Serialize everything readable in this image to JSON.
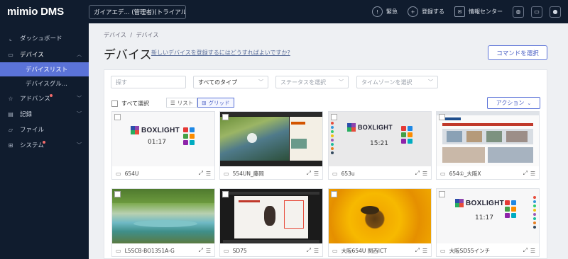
{
  "app": {
    "logo": "mimio DMS",
    "tenant": "ガイアエデ... (管理者)(トライアル)"
  },
  "topbar": {
    "emergency": "緊急",
    "register": "登録する",
    "info_center": "情報センター"
  },
  "sidebar": {
    "dashboard": "ダッシュボード",
    "devices": "デバイス",
    "device_list": "デバイスリスト",
    "device_groups": "デバイスグル...",
    "advanced": "アドバンス",
    "records": "記録",
    "files": "ファイル",
    "system": "システム"
  },
  "main": {
    "breadcrumb_root": "デバイス",
    "breadcrumb_sep": "/",
    "breadcrumb_current": "デバイス",
    "title": "デバイス",
    "help_link": "新しいデバイスを登録するにはどうすればよいですか?",
    "command_button": "コマンドを選択"
  },
  "filters": {
    "search_placeholder": "探す",
    "type_value": "すべてのタイプ",
    "status_placeholder": "ステータスを選択",
    "timezone_placeholder": "タイムゾーンを選択"
  },
  "toolbar": {
    "select_all": "すべて選択",
    "list": "リスト",
    "grid": "グリッド",
    "actions": "アクション"
  },
  "devices": [
    {
      "name": "654U",
      "clock": "01:17"
    },
    {
      "name": "554UN_藤岡"
    },
    {
      "name": "653u",
      "clock": "15:21"
    },
    {
      "name": "654①_大阪X"
    },
    {
      "name": "L5SCB-BO1351A-G"
    },
    {
      "name": "SD75"
    },
    {
      "name": "大阪654U 関西ICT"
    },
    {
      "name": "大阪SD55インチ",
      "clock": "11:17"
    }
  ],
  "brand_text": "BOXLIGHT"
}
